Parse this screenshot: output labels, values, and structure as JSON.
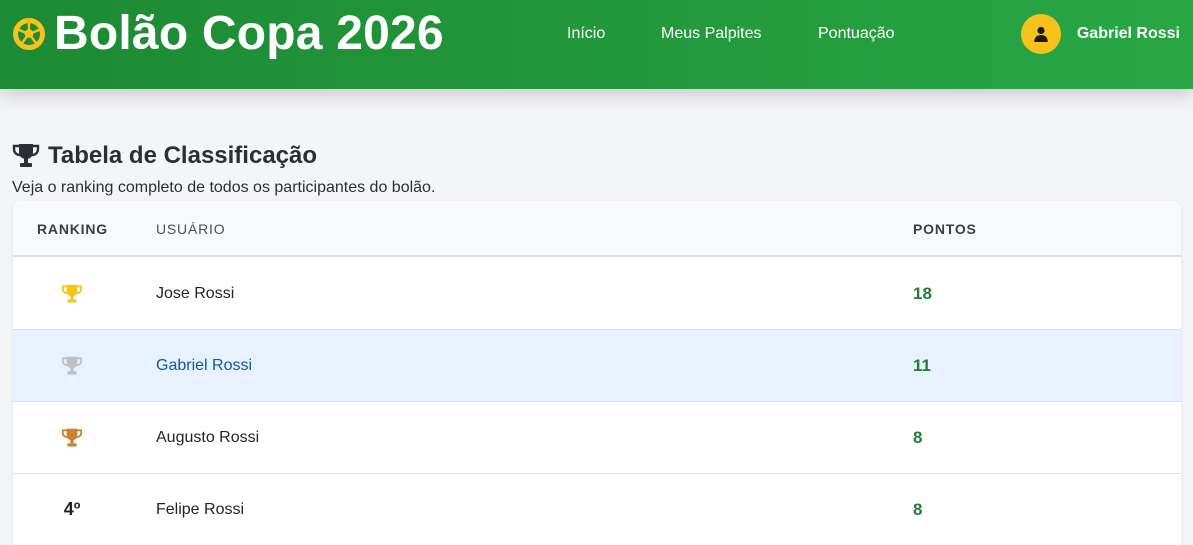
{
  "header": {
    "title": "Bolão Copa 2026",
    "logo_icon": "soccer-ball-icon",
    "nav": [
      {
        "id": "inicio",
        "label": "Início"
      },
      {
        "id": "meus-palpites",
        "label": "Meus Palpites"
      },
      {
        "id": "pontuacao",
        "label": "Pontuação"
      }
    ],
    "user": {
      "name": "Gabriel Rossi",
      "avatar_icon": "user-icon",
      "avatar_color": "#f7c21b"
    },
    "colors": {
      "primary": "#28a745",
      "primary_dark": "#1d8a34"
    }
  },
  "page": {
    "title": "Tabela de Classificação",
    "title_icon": "trophy-icon",
    "subtitle": "Veja o ranking completo de todos os participantes do bolão."
  },
  "table": {
    "headers": {
      "ranking": "RANKING",
      "usuario": "USUÁRIO",
      "pontos": "PONTOS"
    },
    "rows": [
      {
        "rank_icon": "gold-trophy-icon",
        "rank_color": "#f5c518",
        "rank_text": "",
        "user": "Jose Rossi",
        "points": "18",
        "highlight": false
      },
      {
        "rank_icon": "silver-trophy-icon",
        "rank_color": "#c0c0c0",
        "rank_text": "",
        "user": "Gabriel Rossi",
        "points": "11",
        "highlight": true
      },
      {
        "rank_icon": "bronze-trophy-icon",
        "rank_color": "#cd7f32",
        "rank_text": "",
        "user": "Augusto Rossi",
        "points": "8",
        "highlight": false
      },
      {
        "rank_icon": "",
        "rank_color": "",
        "rank_text": "4º",
        "user": "Felipe Rossi",
        "points": "8",
        "highlight": false
      }
    ],
    "colors": {
      "points": "#1e7e34",
      "highlight_row": "#e7f1ff",
      "highlight_user": "#0d5aa7"
    }
  }
}
